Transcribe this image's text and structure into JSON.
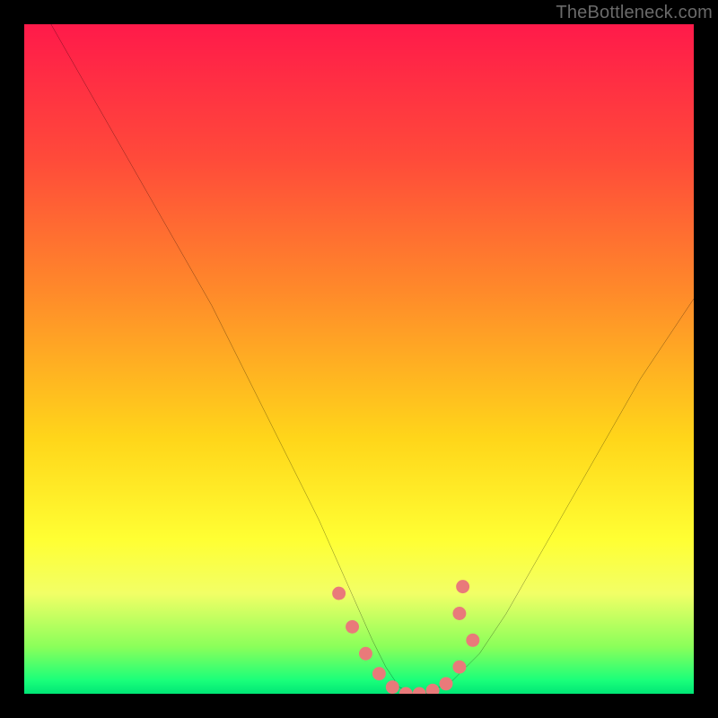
{
  "watermark": "TheBottleneck.com",
  "chart_data": {
    "type": "line",
    "title": "",
    "xlabel": "",
    "ylabel": "",
    "xlim": [
      0,
      100
    ],
    "ylim": [
      0,
      100
    ],
    "series": [
      {
        "name": "bottleneck-curve",
        "x": [
          0,
          4,
          8,
          12,
          16,
          20,
          24,
          28,
          32,
          36,
          40,
          44,
          48,
          52,
          54,
          56,
          58,
          60,
          64,
          68,
          72,
          76,
          80,
          84,
          88,
          92,
          96,
          100
        ],
        "values": [
          106,
          100,
          93,
          86,
          79,
          72,
          65,
          58,
          50,
          42,
          34,
          26,
          17,
          8,
          4,
          1,
          0,
          0,
          2,
          6,
          12,
          19,
          26,
          33,
          40,
          47,
          53,
          59
        ]
      }
    ],
    "markers": {
      "name": "highlight-points",
      "x": [
        47,
        49,
        51,
        53,
        55,
        57,
        59,
        61,
        63,
        65,
        67,
        65,
        65.5
      ],
      "values": [
        15,
        10,
        6,
        3,
        1,
        0,
        0,
        0.5,
        1.5,
        4,
        8,
        12,
        16
      ],
      "color": "#e97a7a"
    }
  },
  "colors": {
    "curve": "#000000",
    "marker": "#e97a7a",
    "frame": "#000000"
  }
}
